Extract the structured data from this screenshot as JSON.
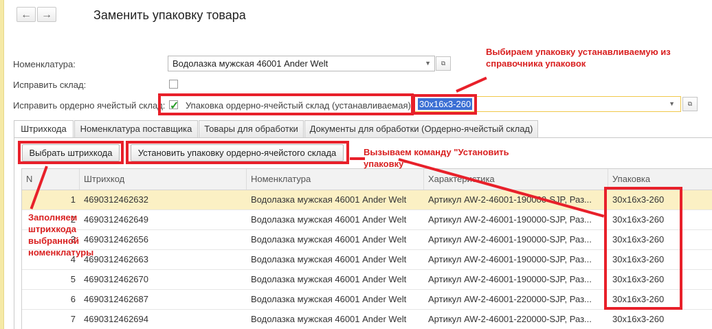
{
  "window": {
    "title": "Заменить упаковку товара"
  },
  "nav": {
    "back_icon": "arrow-left-icon",
    "forward_icon": "arrow-right-icon"
  },
  "form": {
    "nomenclature_label": "Номенклатура:",
    "nomenclature_value": "Водолазка мужская 46001 Ander Welt",
    "fix_warehouse_label": "Исправить склад:",
    "fix_warehouse_checked": false,
    "fix_cell_label": "Исправить ордерно ячейстый склад:",
    "fix_cell_checked": true,
    "package_label": "Упаковка ордерно-ячейстый склад (устанавливаемая):",
    "package_value": "30x16x3-260"
  },
  "tabs": [
    {
      "label": "Штрихкода",
      "active": true
    },
    {
      "label": "Номенклатура поставщика",
      "active": false
    },
    {
      "label": "Товары для обработки",
      "active": false
    },
    {
      "label": "Документы для обработки (Ордерно-ячейстый склад)",
      "active": false
    }
  ],
  "toolbar": {
    "select_barcode_label": "Выбрать штрихкода",
    "set_package_label": "Установить упаковку ордерно-ячейстого склада"
  },
  "table": {
    "columns": [
      "N",
      "Штрихкод",
      "Номенклатура",
      "Характеристика",
      "Упаковка"
    ],
    "rows": [
      {
        "n": "1",
        "barcode": "4690312462632",
        "nomenclature": "Водолазка мужская 46001 Ander Welt",
        "characteristic": "Артикул AW-2-46001-190000-SJP, Раз...",
        "package": "30x16x3-260",
        "selected": true
      },
      {
        "n": "2",
        "barcode": "4690312462649",
        "nomenclature": "Водолазка мужская 46001 Ander Welt",
        "characteristic": "Артикул AW-2-46001-190000-SJP, Раз...",
        "package": "30x16x3-260"
      },
      {
        "n": "3",
        "barcode": "4690312462656",
        "nomenclature": "Водолазка мужская 46001 Ander Welt",
        "characteristic": "Артикул AW-2-46001-190000-SJP, Раз...",
        "package": "30x16x3-260"
      },
      {
        "n": "4",
        "barcode": "4690312462663",
        "nomenclature": "Водолазка мужская 46001 Ander Welt",
        "characteristic": "Артикул AW-2-46001-190000-SJP, Раз...",
        "package": "30x16x3-260"
      },
      {
        "n": "5",
        "barcode": "4690312462670",
        "nomenclature": "Водолазка мужская 46001 Ander Welt",
        "characteristic": "Артикул AW-2-46001-190000-SJP, Раз...",
        "package": "30x16x3-260"
      },
      {
        "n": "6",
        "barcode": "4690312462687",
        "nomenclature": "Водолазка мужская 46001 Ander Welt",
        "characteristic": "Артикул AW-2-46001-220000-SJP, Раз...",
        "package": "30x16x3-260"
      },
      {
        "n": "7",
        "barcode": "4690312462694",
        "nomenclature": "Водолазка мужская 46001 Ander Welt",
        "characteristic": "Артикул AW-2-46001-220000-SJP, Раз...",
        "package": "30x16x3-260"
      }
    ]
  },
  "annotations": {
    "choose_package": "Выбираем упаковку устанавливаемую из справочника упаковок",
    "call_command": "Вызываем команду \"Установить упаковку\"",
    "fill_barcodes": "Заполняем штрихкода выбранной номенклатуры",
    "color": "#e8202a"
  }
}
